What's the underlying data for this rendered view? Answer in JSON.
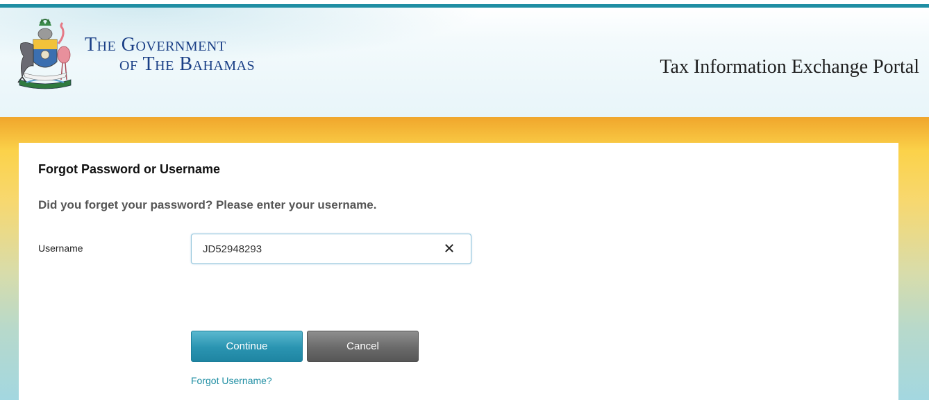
{
  "header": {
    "gov_title_line1": "The Government",
    "gov_title_line2": "of The Bahamas",
    "portal_title": "Tax Information Exchange Portal"
  },
  "form": {
    "heading": "Forgot Password or Username",
    "subheading": "Did you forget your password? Please enter your username.",
    "username_label": "Username",
    "username_value": "JD52948293",
    "clear_icon": "close-icon",
    "continue_label": "Continue",
    "cancel_label": "Cancel",
    "forgot_username_link": "Forgot Username?"
  },
  "colors": {
    "accent_teal": "#1f8ea3",
    "title_blue": "#1a3f86",
    "frame_orange": "#f0a62c",
    "frame_yellow": "#fbd24a",
    "frame_cyan": "#a3d7e0",
    "button_continue": "#2a94b1",
    "button_cancel": "#6a6a6a"
  }
}
